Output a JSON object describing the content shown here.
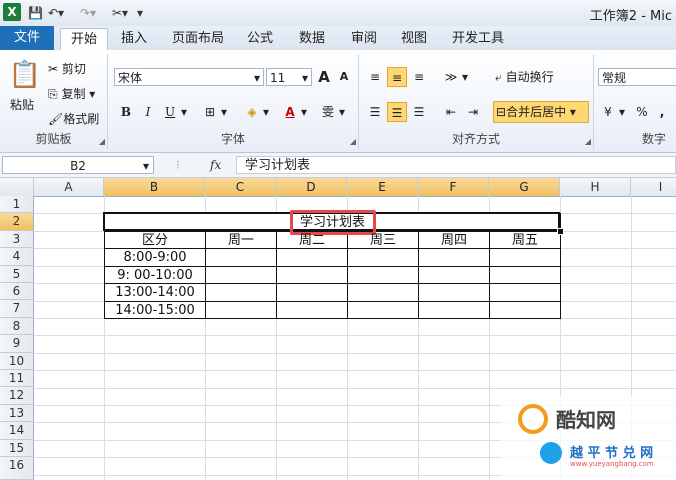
{
  "titlebar": {
    "title": "工作簿2 - Mic"
  },
  "tabs": [
    "文件",
    "开始",
    "插入",
    "页面布局",
    "公式",
    "数据",
    "审阅",
    "视图",
    "开发工具"
  ],
  "ribbon": {
    "clipboard": {
      "paste": "粘贴",
      "cut": "剪切",
      "copy": "复制",
      "format_painter": "格式刷",
      "label": "剪贴板"
    },
    "font": {
      "name": "宋体",
      "size": "11",
      "grow": "A",
      "shrink": "A",
      "bold": "B",
      "italic": "I",
      "underline": "U",
      "wen": "雯",
      "label": "字体"
    },
    "align": {
      "wrap": "自动换行",
      "merge": "合并后居中",
      "label": "对齐方式"
    },
    "number": {
      "format": "常规",
      "percent": "%",
      "comma": ",",
      "label": "数字"
    }
  },
  "formula_bar": {
    "name_box": "B2",
    "fx": "fx",
    "content": "学习计划表"
  },
  "columns": [
    "A",
    "B",
    "C",
    "D",
    "E",
    "F",
    "G",
    "H",
    "I"
  ],
  "rows": [
    "1",
    "2",
    "3",
    "4",
    "5",
    "6",
    "7",
    "8",
    "9",
    "10",
    "11",
    "12",
    "13",
    "14",
    "15",
    "16"
  ],
  "sheet": {
    "title": "学习计划表",
    "header": [
      "区分",
      "周一",
      "周二",
      "周三",
      "周四",
      "周五"
    ],
    "times": [
      "8:00-9:00",
      "9: 00-10:00",
      "13:00-14:00",
      "14:00-15:00"
    ]
  },
  "watermark": {
    "text1": "酷知网",
    "text2": "越 平 节 兑 网",
    "url": "www.yueyangbang.com"
  },
  "colors": {
    "file_tab": "#1f6fb8",
    "highlight": "#e8474c",
    "selected_header": "#f1c15f"
  }
}
